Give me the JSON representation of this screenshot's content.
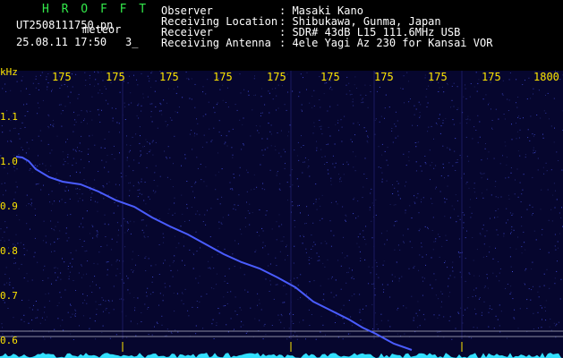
{
  "header": {
    "title": "H R O F F T",
    "filename": "UT2508111750.pn",
    "tag": "meteor",
    "datetime": "25.08.11 17:50",
    "cursor": "3_"
  },
  "info": [
    {
      "key": "Observer",
      "value": ": Masaki Kano"
    },
    {
      "key": "Receiving Location",
      "value": ": Shibukawa, Gunma, Japan"
    },
    {
      "key": "Receiver",
      "value": ": SDR# 43dB L15 111.6MHz USB"
    },
    {
      "key": "Receiving Antenna",
      "value": ": 4ele Yagi Az 230 for Kansai VOR"
    }
  ],
  "axes": {
    "y_unit": "kHz",
    "y_ticks": [
      "1.1",
      "1.0",
      "0.9",
      "0.8",
      "0.7",
      "0.6"
    ],
    "x_ticks": [
      "175",
      "175",
      "175",
      "175",
      "175",
      "175",
      "175",
      "175",
      "175",
      "1800"
    ]
  },
  "colors": {
    "background": "#000000",
    "plot_bg": "#06062e",
    "trail": "#4a5cff",
    "axis_text": "#ffe600",
    "title": "#33e84a",
    "spectrum": "#33e0ff"
  }
}
